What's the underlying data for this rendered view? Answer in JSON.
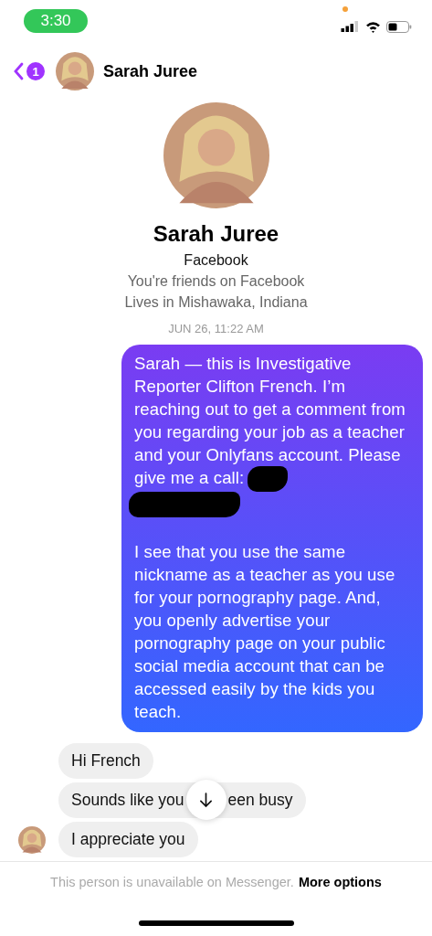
{
  "status_bar": {
    "time": "3:30",
    "mic_in_use": true
  },
  "header": {
    "unread_count": "1",
    "name": "Sarah Juree"
  },
  "profile": {
    "name": "Sarah Juree",
    "source": "Facebook",
    "details": [
      "You're friends on Facebook",
      "Lives in Mishawaka, Indiana"
    ]
  },
  "timestamp": "JUN 26, 11:22 AM",
  "messages": [
    {
      "kind": "sent",
      "parts": [
        {
          "kind": "text",
          "text": "Sarah — this is Investigative Reporter Clifton French. I’m reaching out to get a comment from you regarding your job as a teacher and your Onlyfans account. Please give me a call:"
        },
        {
          "kind": "redaction"
        },
        {
          "kind": "break"
        },
        {
          "kind": "redaction"
        },
        {
          "kind": "paragraph"
        },
        {
          "kind": "text",
          "text": "I see that you use the same nickname as a teacher as you use for your pornography page. And, you openly advertise your pornography page on your public social media account that can be accessed easily by the kids you teach."
        }
      ]
    },
    {
      "kind": "received",
      "parts": [
        {
          "kind": "text",
          "text": "Hi French"
        }
      ]
    },
    {
      "kind": "received",
      "parts": [
        {
          "kind": "text",
          "text": "Sounds like you"
        },
        {
          "kind": "scroll_button"
        },
        {
          "kind": "text",
          "text": "een busy"
        }
      ]
    },
    {
      "kind": "received",
      "avatar": true,
      "parts": [
        {
          "kind": "text",
          "text": "I appreciate you"
        }
      ]
    }
  ],
  "footer": {
    "notice": "This person is unavailable on Messenger.",
    "link": "More options"
  }
}
